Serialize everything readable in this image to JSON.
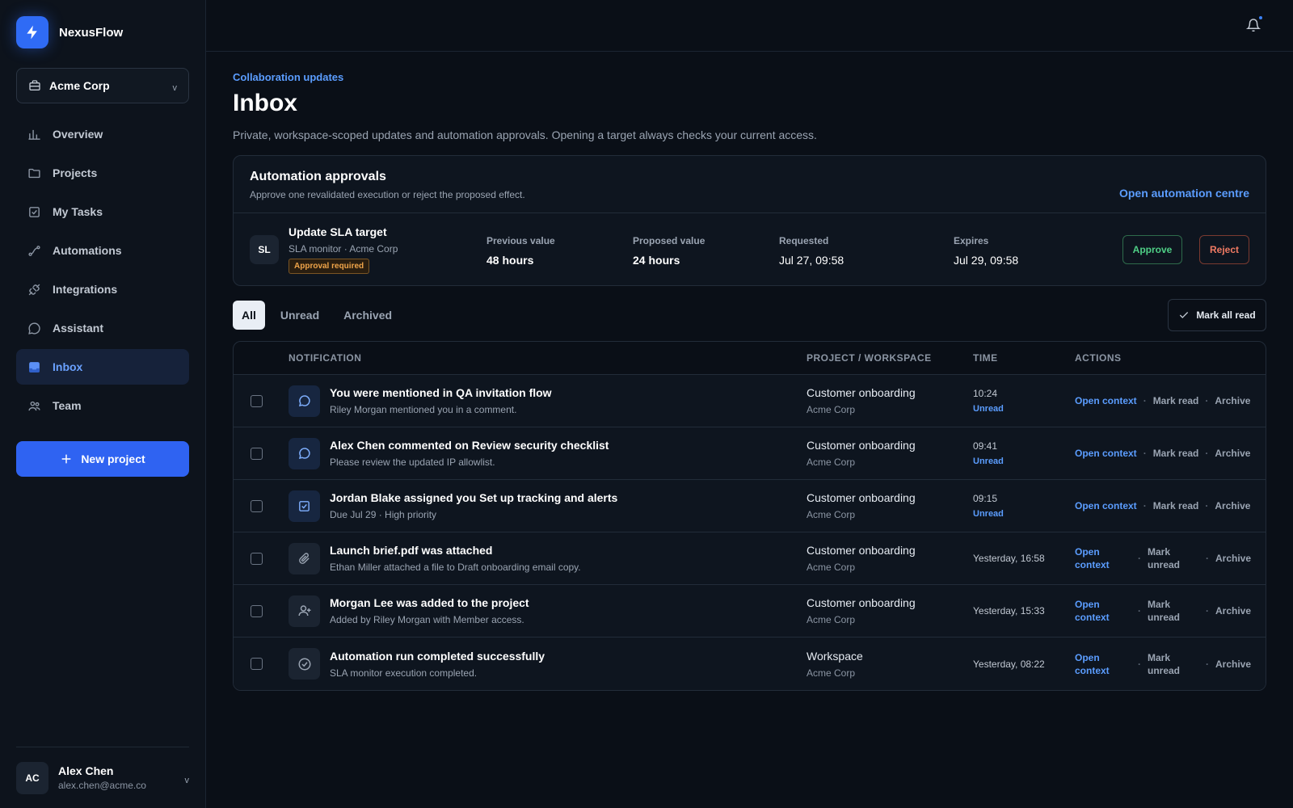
{
  "app": {
    "name": "NexusFlow"
  },
  "workspace": {
    "name": "Acme Corp"
  },
  "nav": [
    {
      "label": "Overview",
      "icon": "chart-icon"
    },
    {
      "label": "Projects",
      "icon": "folder-icon"
    },
    {
      "label": "My Tasks",
      "icon": "task-icon"
    },
    {
      "label": "Automations",
      "icon": "automation-icon"
    },
    {
      "label": "Integrations",
      "icon": "plug-icon"
    },
    {
      "label": "Assistant",
      "icon": "chat-icon"
    },
    {
      "label": "Inbox",
      "icon": "inbox-icon",
      "active": true
    },
    {
      "label": "Team",
      "icon": "team-icon"
    }
  ],
  "new_project_label": "New project",
  "user": {
    "initials": "AC",
    "name": "Alex Chen",
    "email": "alex.chen@acme.co"
  },
  "page": {
    "eyebrow": "Collaboration updates",
    "title": "Inbox",
    "description": "Private, workspace-scoped updates and automation approvals. Opening a target always checks your current access."
  },
  "approvals": {
    "title": "Automation approvals",
    "subtitle": "Approve one revalidated execution or reject the proposed effect.",
    "link": "Open automation centre",
    "item": {
      "initials": "SL",
      "name": "Update SLA target",
      "source": "SLA monitor · Acme Corp",
      "badge": "Approval required",
      "previous_label": "Previous value",
      "previous_value": "48 hours",
      "proposed_label": "Proposed value",
      "proposed_value": "24 hours",
      "requested_label": "Requested",
      "requested_value": "Jul 27, 09:58",
      "expires_label": "Expires",
      "expires_value": "Jul 29, 09:58",
      "approve_label": "Approve",
      "reject_label": "Reject"
    }
  },
  "tabs": [
    "All",
    "Unread",
    "Archived"
  ],
  "mark_all_label": "Mark all read",
  "table": {
    "headers": [
      "NOTIFICATION",
      "PROJECT / WORKSPACE",
      "TIME",
      "ACTIONS"
    ],
    "rows": [
      {
        "icon": "comment-icon",
        "title": "You were mentioned in QA invitation flow",
        "sub": "Riley Morgan mentioned you in a comment.",
        "project": "Customer onboarding",
        "workspace": "Acme Corp",
        "time": "10:24",
        "status": "Unread",
        "open": "Open context",
        "mark": "Mark read",
        "archive": "Archive"
      },
      {
        "icon": "comment-icon",
        "title": "Alex Chen commented on Review security checklist",
        "sub": "Please review the updated IP allowlist.",
        "project": "Customer onboarding",
        "workspace": "Acme Corp",
        "time": "09:41",
        "status": "Unread",
        "open": "Open context",
        "mark": "Mark read",
        "archive": "Archive"
      },
      {
        "icon": "task-check-icon",
        "title": "Jordan Blake assigned you Set up tracking and alerts",
        "sub": "Due Jul 29 · High priority",
        "project": "Customer onboarding",
        "workspace": "Acme Corp",
        "time": "09:15",
        "status": "Unread",
        "open": "Open context",
        "mark": "Mark read",
        "archive": "Archive"
      },
      {
        "icon": "paperclip-icon",
        "title": "Launch brief.pdf was attached",
        "sub": "Ethan Miller attached a file to Draft onboarding email copy.",
        "project": "Customer onboarding",
        "workspace": "Acme Corp",
        "time": "Yesterday, 16:58",
        "status": "",
        "open": "Open context",
        "mark": "Mark unread",
        "archive": "Archive"
      },
      {
        "icon": "user-add-icon",
        "title": "Morgan Lee was added to the project",
        "sub": "Added by Riley Morgan with Member access.",
        "project": "Customer onboarding",
        "workspace": "Acme Corp",
        "time": "Yesterday, 15:33",
        "status": "",
        "open": "Open context",
        "mark": "Mark unread",
        "archive": "Archive"
      },
      {
        "icon": "check-circle-icon",
        "title": "Automation run completed successfully",
        "sub": "SLA monitor execution completed.",
        "project": "Workspace",
        "workspace": "Acme Corp",
        "time": "Yesterday, 08:22",
        "status": "",
        "open": "Open context",
        "mark": "Mark unread",
        "archive": "Archive"
      }
    ]
  }
}
